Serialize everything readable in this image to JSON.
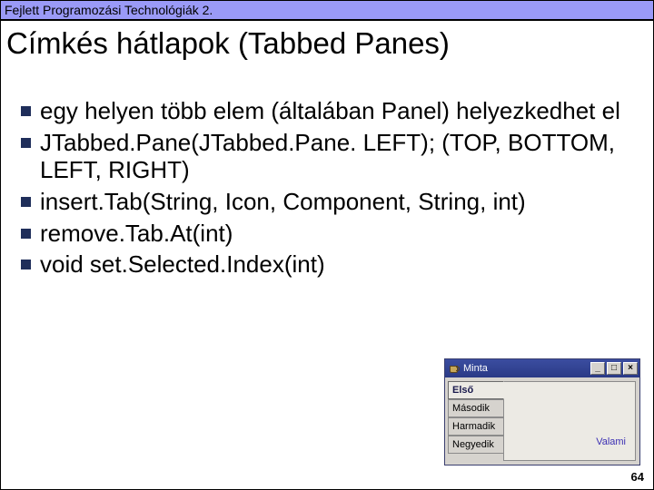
{
  "header": {
    "course": "Fejlett Programozási Technológiák 2."
  },
  "title": "Címkés hátlapok (Tabbed Panes)",
  "bullets": [
    "egy helyen több elem (általában Panel) helyezkedhet el",
    "JTabbed.Pane(JTabbed.Pane. LEFT); (TOP, BOTTOM, LEFT, RIGHT)",
    "insert.Tab(String, Icon, Component, String, int)",
    "remove.Tab.At(int)",
    "void set.Selected.Index(int)"
  ],
  "page_number": "64",
  "screenshot": {
    "window_title": "Minta",
    "btn_min": "_",
    "btn_max": "□",
    "btn_close": "×",
    "tabs": [
      "Első",
      "Második",
      "Harmadik",
      "Negyedik"
    ],
    "selected_tab_index": 0,
    "pane_label": "Valami"
  }
}
